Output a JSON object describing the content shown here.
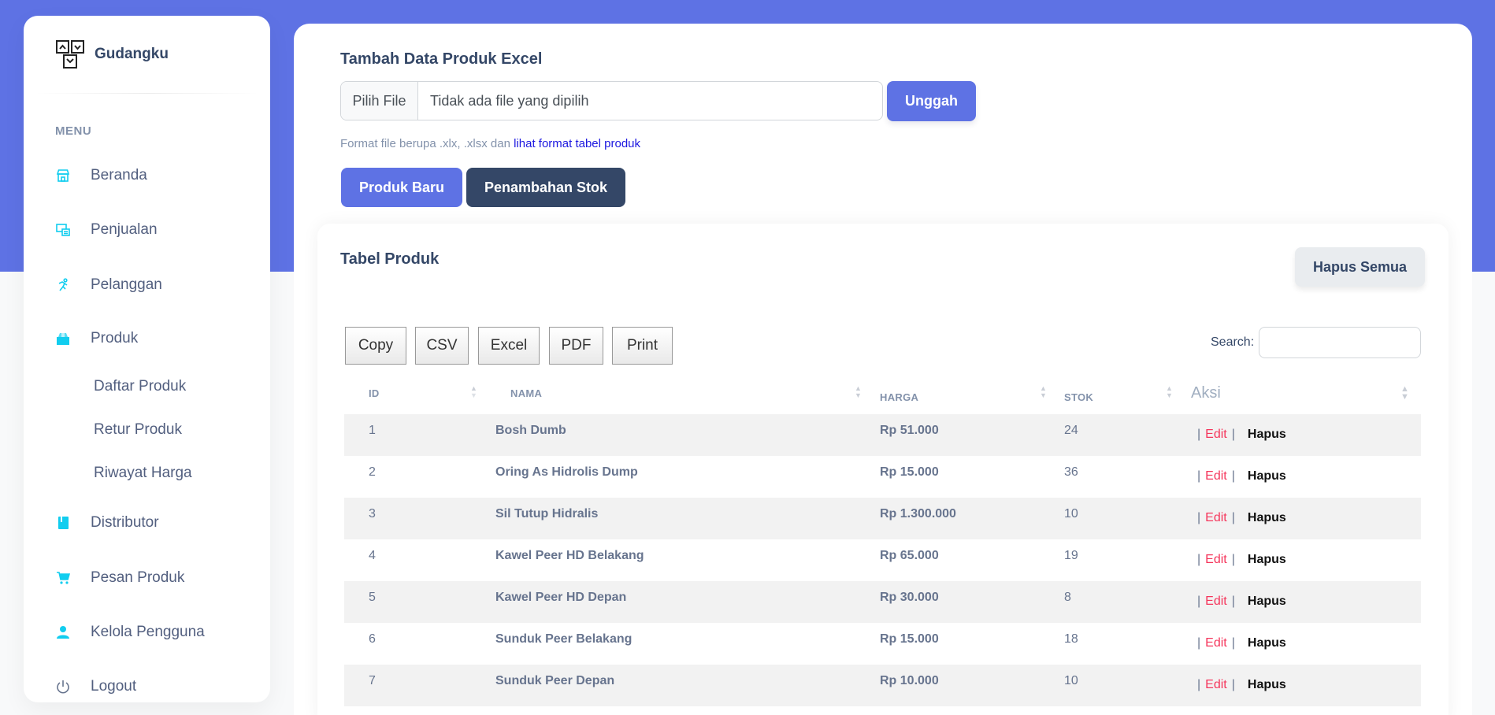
{
  "brand": {
    "name": "Gudangku"
  },
  "sidebar": {
    "menu_heading": "MENU",
    "items": [
      {
        "label": "Beranda",
        "icon": "shop-icon"
      },
      {
        "label": "Penjualan",
        "icon": "monitor-icon"
      },
      {
        "label": "Pelanggan",
        "icon": "running-icon"
      },
      {
        "label": "Produk",
        "icon": "box-icon"
      },
      {
        "label": "Distributor",
        "icon": "book-icon"
      },
      {
        "label": "Pesan Produk",
        "icon": "cart-icon"
      },
      {
        "label": "Kelola Pengguna",
        "icon": "user-icon"
      },
      {
        "label": "Logout",
        "icon": "power-icon"
      }
    ],
    "sub_items": [
      "Daftar Produk",
      "Retur Produk",
      "Riwayat Harga"
    ]
  },
  "upload": {
    "title": "Tambah Data Produk Excel",
    "file_button": "Pilih File",
    "file_status": "Tidak ada file yang dipilih",
    "submit": "Unggah",
    "note": "Format file berupa .xlx, .xlsx dan",
    "note_link": "lihat format tabel produk",
    "btn_new": "Produk Baru",
    "btn_stock": "Penambahan Stok"
  },
  "table": {
    "title": "Tabel Produk",
    "delete_all": "Hapus Semua",
    "export_buttons": [
      "Copy",
      "CSV",
      "Excel",
      "PDF",
      "Print"
    ],
    "search_label": "Search:",
    "columns": [
      "ID",
      "NAMA",
      "HARGA",
      "STOK",
      "Aksi"
    ],
    "edit_label": "Edit",
    "delete_label": "Hapus",
    "rows": [
      {
        "id": "1",
        "nama": "Bosh Dumb",
        "harga": "Rp 51.000",
        "stok": "24"
      },
      {
        "id": "2",
        "nama": "Oring As Hidrolis Dump",
        "harga": "Rp 15.000",
        "stok": "36"
      },
      {
        "id": "3",
        "nama": "Sil Tutup Hidralis",
        "harga": "Rp 1.300.000",
        "stok": "10"
      },
      {
        "id": "4",
        "nama": "Kawel Peer HD Belakang",
        "harga": "Rp 65.000",
        "stok": "19"
      },
      {
        "id": "5",
        "nama": "Kawel Peer HD Depan",
        "harga": "Rp 30.000",
        "stok": "8"
      },
      {
        "id": "6",
        "nama": "Sunduk Peer Belakang",
        "harga": "Rp 15.000",
        "stok": "18"
      },
      {
        "id": "7",
        "nama": "Sunduk Peer Depan",
        "harga": "Rp 10.000",
        "stok": "10"
      }
    ]
  },
  "colors": {
    "primary": "#5e72e4",
    "dark": "#344767",
    "icon_cyan": "#11cdef",
    "edit_red": "#f5365c"
  }
}
